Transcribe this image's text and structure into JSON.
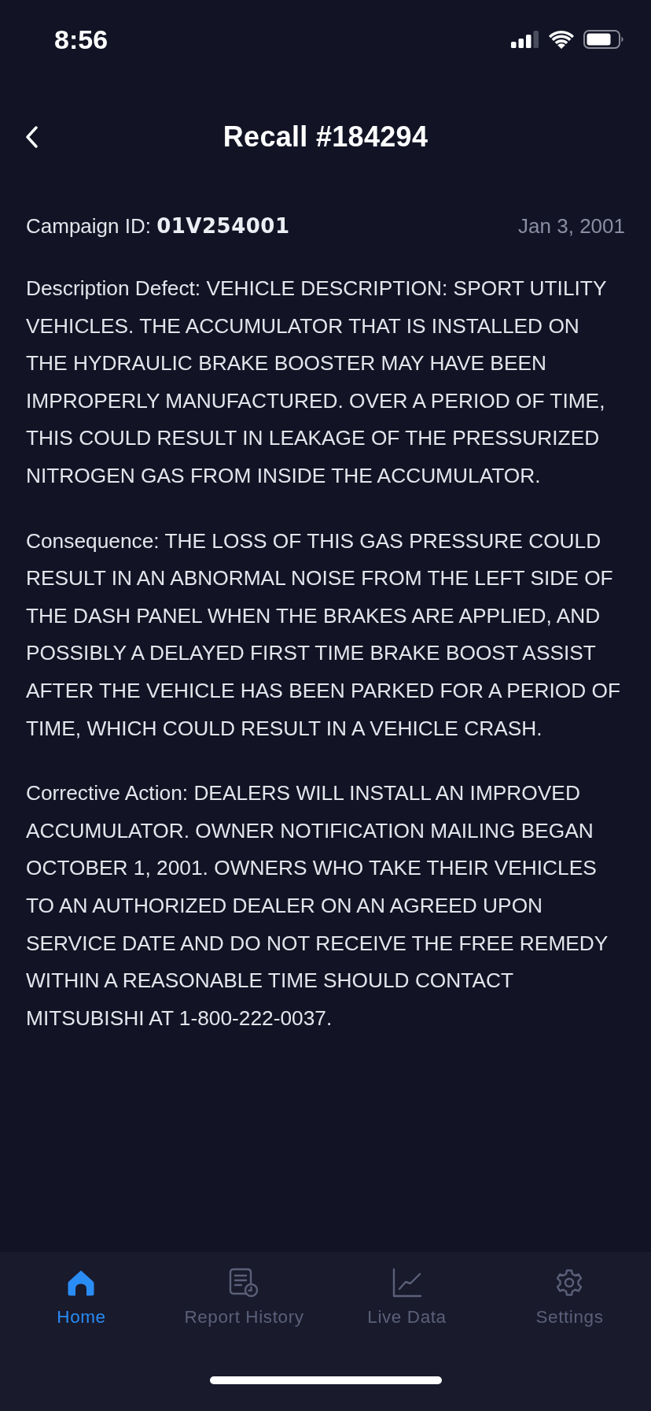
{
  "status_bar": {
    "time": "8:56"
  },
  "header": {
    "title": "Recall #184294"
  },
  "campaign": {
    "id_text": "Campaign ID: **01V254001**",
    "date": "Jan 3, 2001"
  },
  "paragraphs": [
    "Description Defect: VEHICLE DESCRIPTION: SPORT UTILITY VEHICLES. THE ACCUMULATOR THAT IS INSTALLED ON THE HYDRAULIC BRAKE BOOSTER MAY HAVE BEEN IMPROPERLY MANUFACTURED. OVER A PERIOD OF TIME, THIS COULD RESULT IN LEAKAGE OF THE PRESSURIZED NITROGEN GAS FROM INSIDE THE ACCUMULATOR.",
    "Consequence: THE LOSS OF THIS GAS PRESSURE COULD RESULT IN AN ABNORMAL NOISE FROM THE LEFT SIDE OF THE DASH PANEL WHEN THE BRAKES ARE APPLIED, AND POSSIBLY A DELAYED FIRST TIME BRAKE BOOST ASSIST AFTER THE VEHICLE HAS BEEN PARKED FOR A PERIOD OF TIME, WHICH COULD RESULT IN A VEHICLE CRASH.",
    "Corrective Action: DEALERS WILL INSTALL AN IMPROVED ACCUMULATOR. OWNER NOTIFICATION MAILING BEGAN OCTOBER 1, 2001. OWNERS WHO TAKE THEIR VEHICLES TO AN AUTHORIZED DEALER ON AN AGREED UPON SERVICE DATE AND DO NOT RECEIVE THE FREE REMEDY WITHIN A REASONABLE TIME SHOULD CONTACT MITSUBISHI AT 1-800-222-0037."
  ],
  "tab_bar": {
    "items": [
      {
        "label": "Home",
        "selected": true
      },
      {
        "label": "Report History",
        "selected": false
      },
      {
        "label": "Live Data",
        "selected": false
      },
      {
        "label": "Settings",
        "selected": false
      }
    ]
  }
}
